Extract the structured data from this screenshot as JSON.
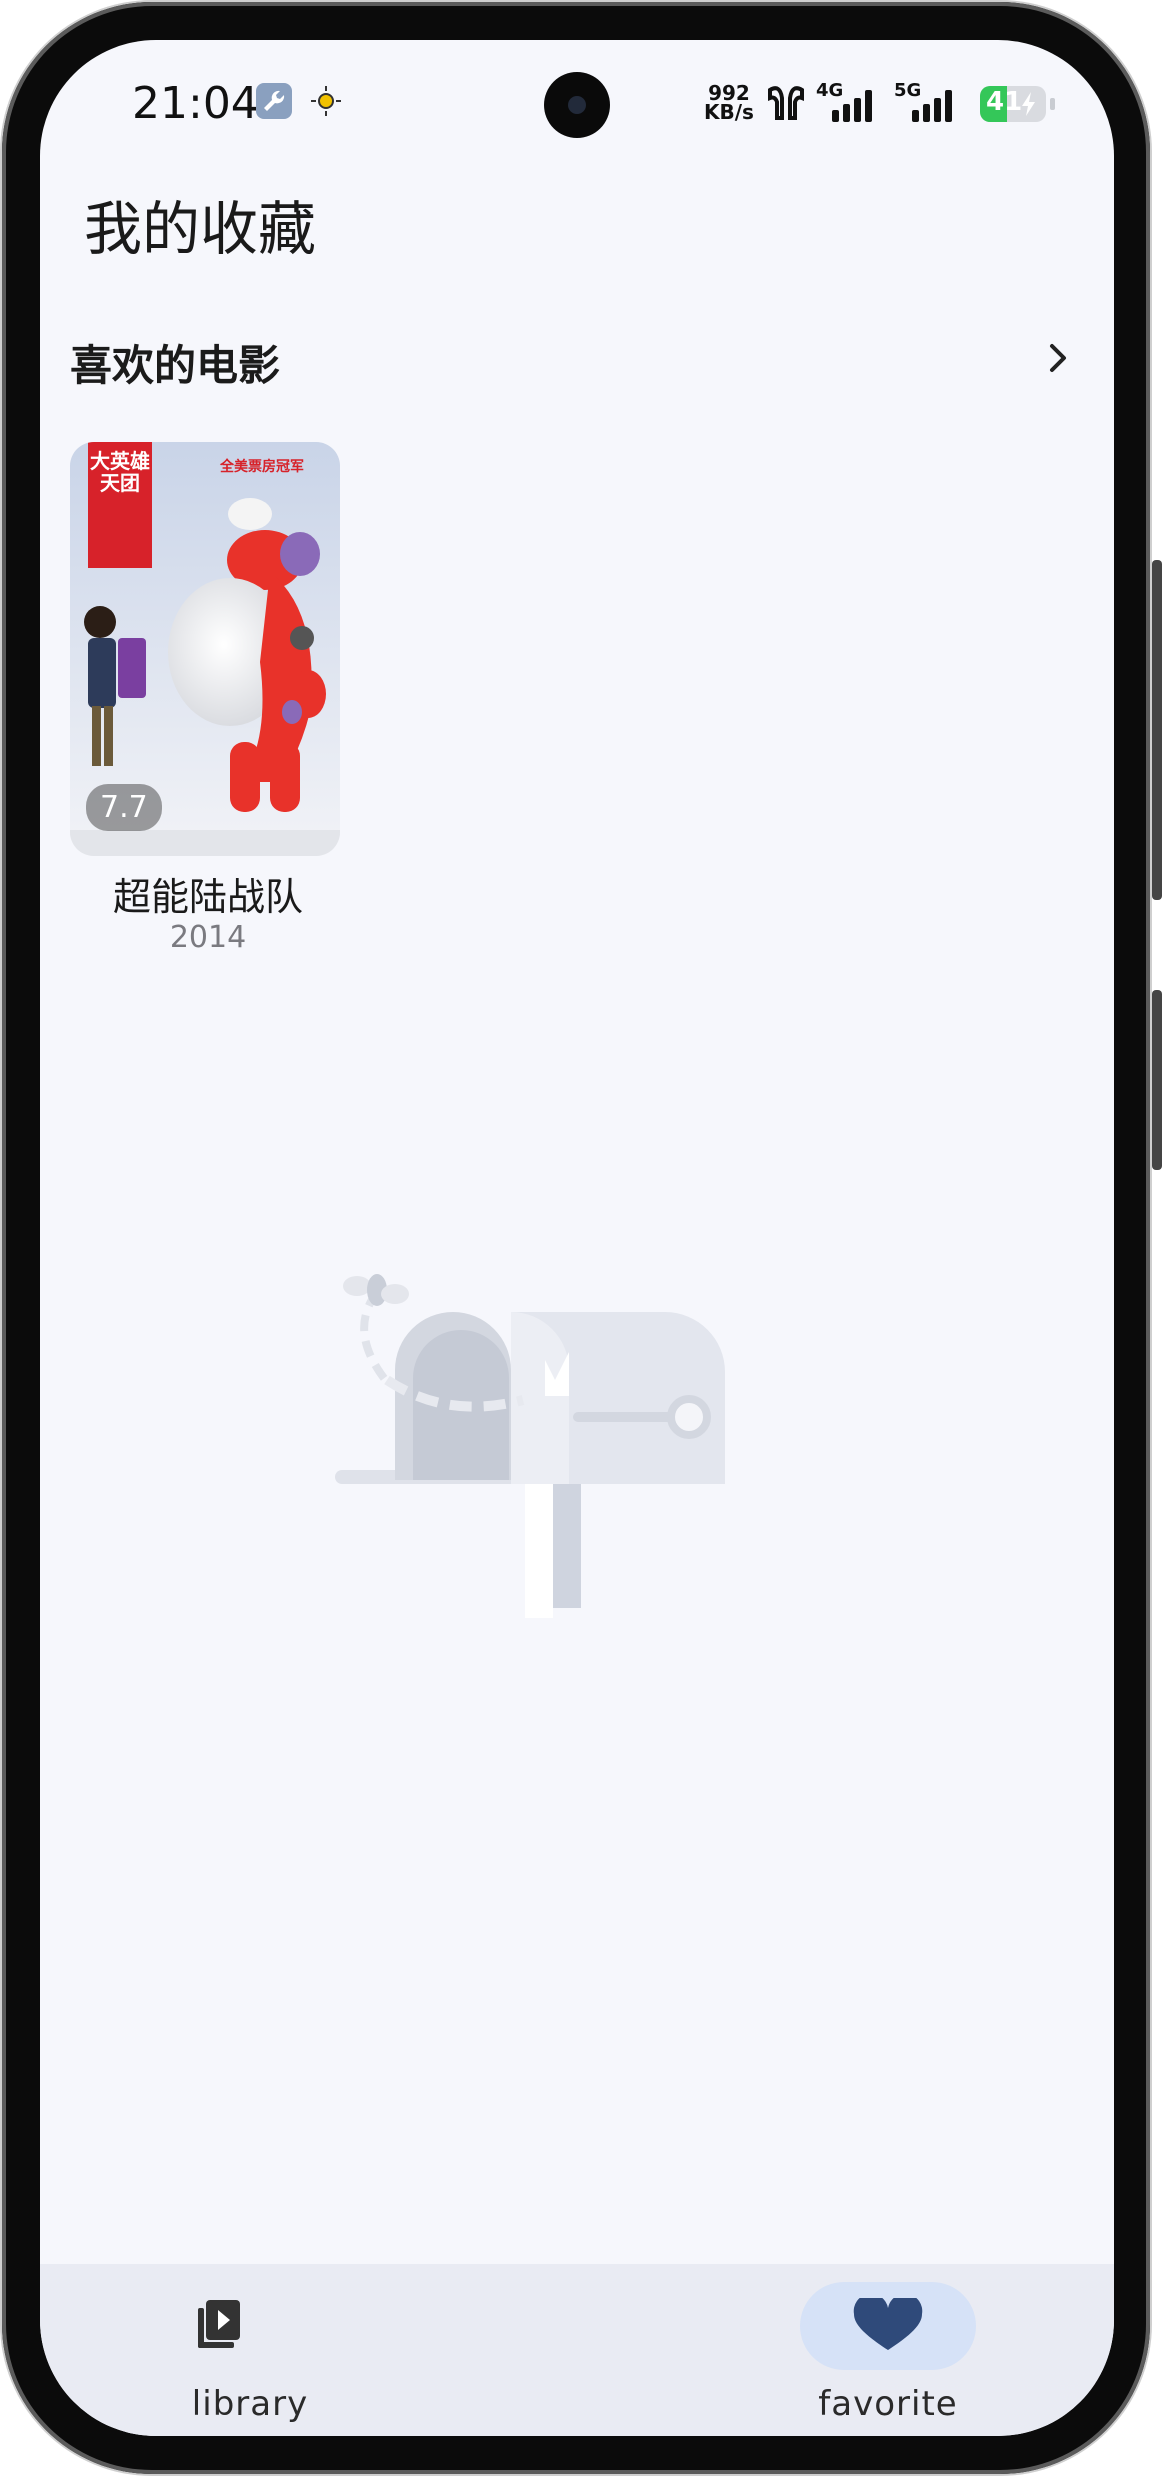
{
  "status_bar": {
    "time": "21:04",
    "net_speed_value": "992",
    "net_speed_unit": "KB/s",
    "signal_1_label": "4G",
    "signal_2_label": "5G",
    "battery_level": "41",
    "icons": [
      "wrench-icon",
      "sun-settings-icon",
      "earbuds-icon",
      "signal-icon",
      "battery-charging-icon"
    ]
  },
  "page": {
    "title": "我的收藏"
  },
  "section": {
    "title": "喜欢的电影"
  },
  "movies": [
    {
      "title": "超能陆战队",
      "year": "2014",
      "rating": "7.7",
      "poster_text": "大英雄天团",
      "poster_tagline": "全美票房冠军"
    }
  ],
  "bottom_nav": {
    "items": [
      {
        "label": "library",
        "icon": "video-library-icon",
        "active": false
      },
      {
        "label": "favorite",
        "icon": "heart-icon",
        "active": true
      }
    ]
  },
  "colors": {
    "background": "#f6f7fc",
    "nav_background": "#e9ebf3",
    "active_pill": "#d6e2f7",
    "icon_primary": "#2f4a7a",
    "battery_green": "#34c759"
  }
}
